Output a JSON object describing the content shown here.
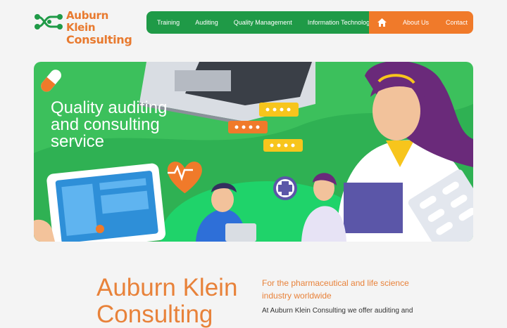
{
  "logo": {
    "line1": "Auburn Klein",
    "line2": "Consulting"
  },
  "nav": {
    "items": [
      "Training",
      "Auditing",
      "Quality Management",
      "Information Technology"
    ],
    "home_icon": "home-icon",
    "secondary": [
      "About Us",
      "Contact"
    ]
  },
  "hero": {
    "title": "Quality auditing and consulting service"
  },
  "main": {
    "heading": "Auburn Klein Consulting",
    "subheading": "For the pharmaceutical and life science industry worldwide",
    "intro": "At Auburn Klein Consulting we offer auditing and"
  },
  "colors": {
    "green": "#1f9a47",
    "orange": "#f07a2a",
    "hero_bg": "#3cc05c",
    "accent_text": "#e8823a"
  }
}
